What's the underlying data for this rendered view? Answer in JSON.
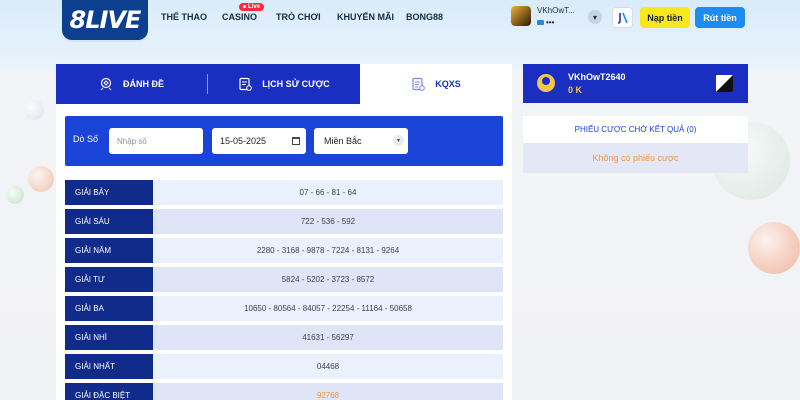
{
  "brand": {
    "logo_text": "8LIVE"
  },
  "nav": {
    "items": [
      {
        "label": "THỂ THAO"
      },
      {
        "label": "CASINO"
      },
      {
        "label": "TRÒ CHƠI"
      },
      {
        "label": "KHUYẾN MÃI"
      },
      {
        "label": "BONG88"
      }
    ],
    "live_badge": "Live"
  },
  "header_user": {
    "name": "VKhOwT...",
    "balance_masked": "•••"
  },
  "actions": {
    "deposit_label": "Nạp tiền",
    "withdraw_label": "Rút tiền"
  },
  "tabs": [
    {
      "label": "ĐÁNH ĐỀ",
      "icon": "lottery-ticket-icon",
      "active": false
    },
    {
      "label": "LỊCH SỬ CƯỢC",
      "icon": "history-receipt-icon",
      "active": false
    },
    {
      "label": "KQXS",
      "icon": "results-list-icon",
      "active": true
    }
  ],
  "filter": {
    "label": "Dò Số",
    "number_placeholder": "Nhập số",
    "date_value": "15-05-2025",
    "region_value": "Miền Bắc"
  },
  "results": [
    {
      "prize": "GIẢI BẢY",
      "numbers": "07 - 66 - 81 - 64"
    },
    {
      "prize": "GIẢI SÁU",
      "numbers": "722 - 536 - 592"
    },
    {
      "prize": "GIẢI NĂM",
      "numbers": "2280 - 3168 - 9878 - 7224 - 8131 - 9264"
    },
    {
      "prize": "GIẢI TƯ",
      "numbers": "5824 - 5202 - 3723 - 8572"
    },
    {
      "prize": "GIẢI BA",
      "numbers": "10650 - 80564 - 84057 - 22254 - 11164 - 50658"
    },
    {
      "prize": "GIẢI NHÌ",
      "numbers": "41631 - 56297"
    },
    {
      "prize": "GIẢI NHẤT",
      "numbers": "04468"
    },
    {
      "prize": "GIẢI ĐẶC BIỆT",
      "numbers": "92768"
    }
  ],
  "profile": {
    "username": "VKhOwT2640",
    "balance": "0 K"
  },
  "pending": {
    "title": "PHIẾU CƯỢC CHỜ KẾT QUẢ (0)",
    "empty_text": "Không có phiếu cược"
  },
  "colors": {
    "primary_blue": "#1a2fc1",
    "filter_blue": "#1a44d8",
    "label_navy": "#102b8a",
    "deposit_yellow": "#f8e71c",
    "withdraw_blue": "#1d8cf0",
    "special_orange": "#f5953b"
  }
}
